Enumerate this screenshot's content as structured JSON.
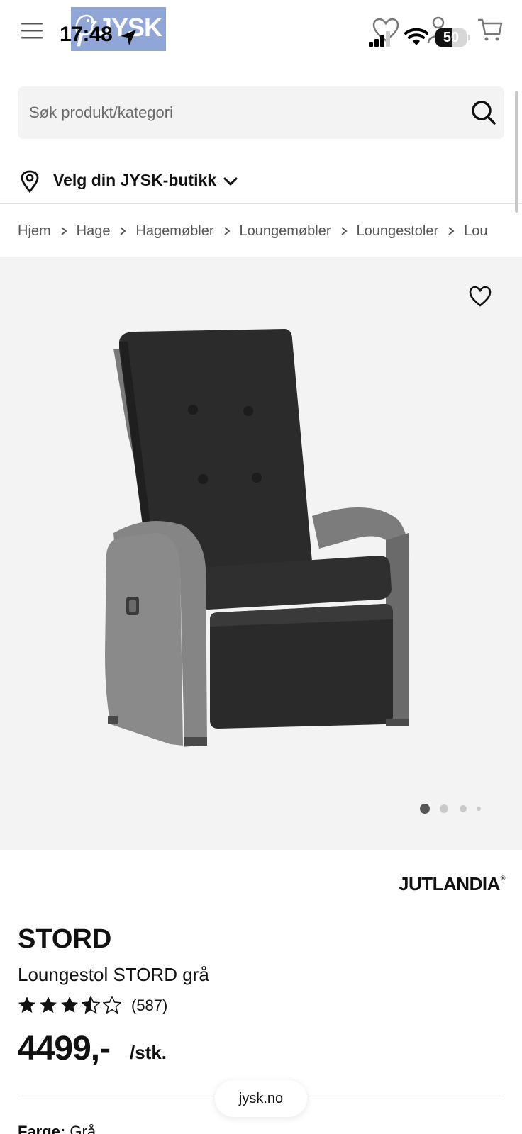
{
  "status_bar": {
    "time": "17:48",
    "battery": "50"
  },
  "header": {
    "logo_text": "JYSK"
  },
  "search": {
    "placeholder": "Søk produkt/kategori"
  },
  "store_selector": {
    "label": "Velg din JYSK-butikk"
  },
  "breadcrumb": [
    "Hjem",
    "Hage",
    "Hagemøbler",
    "Loungemøbler",
    "Loungestoler",
    "Lou"
  ],
  "gallery": {
    "slide_count": 4,
    "active_slide": 1
  },
  "product": {
    "brand": "JUTLANDIA",
    "brand_mark": "®",
    "name": "STORD",
    "subtitle": "Loungestol STORD grå",
    "rating": 3.5,
    "rating_max": 5,
    "rating_count": "(587)",
    "price": "4499,-",
    "unit": "/stk.",
    "color_label": "Farge:",
    "color_value": "Grå"
  },
  "footer_pill": {
    "domain": "jysk.no"
  },
  "colors": {
    "accent": "#111111",
    "gallery_bg": "#f3f3f3",
    "search_bg": "#f3f3f3",
    "logo_bg": "#8fa6d6"
  },
  "icons": [
    "menu-icon",
    "heart-icon",
    "user-icon",
    "cart-icon",
    "search-icon",
    "location-pin-icon",
    "chevron-down-icon",
    "chevron-right-icon",
    "wishlist-heart-icon",
    "star-icon"
  ]
}
